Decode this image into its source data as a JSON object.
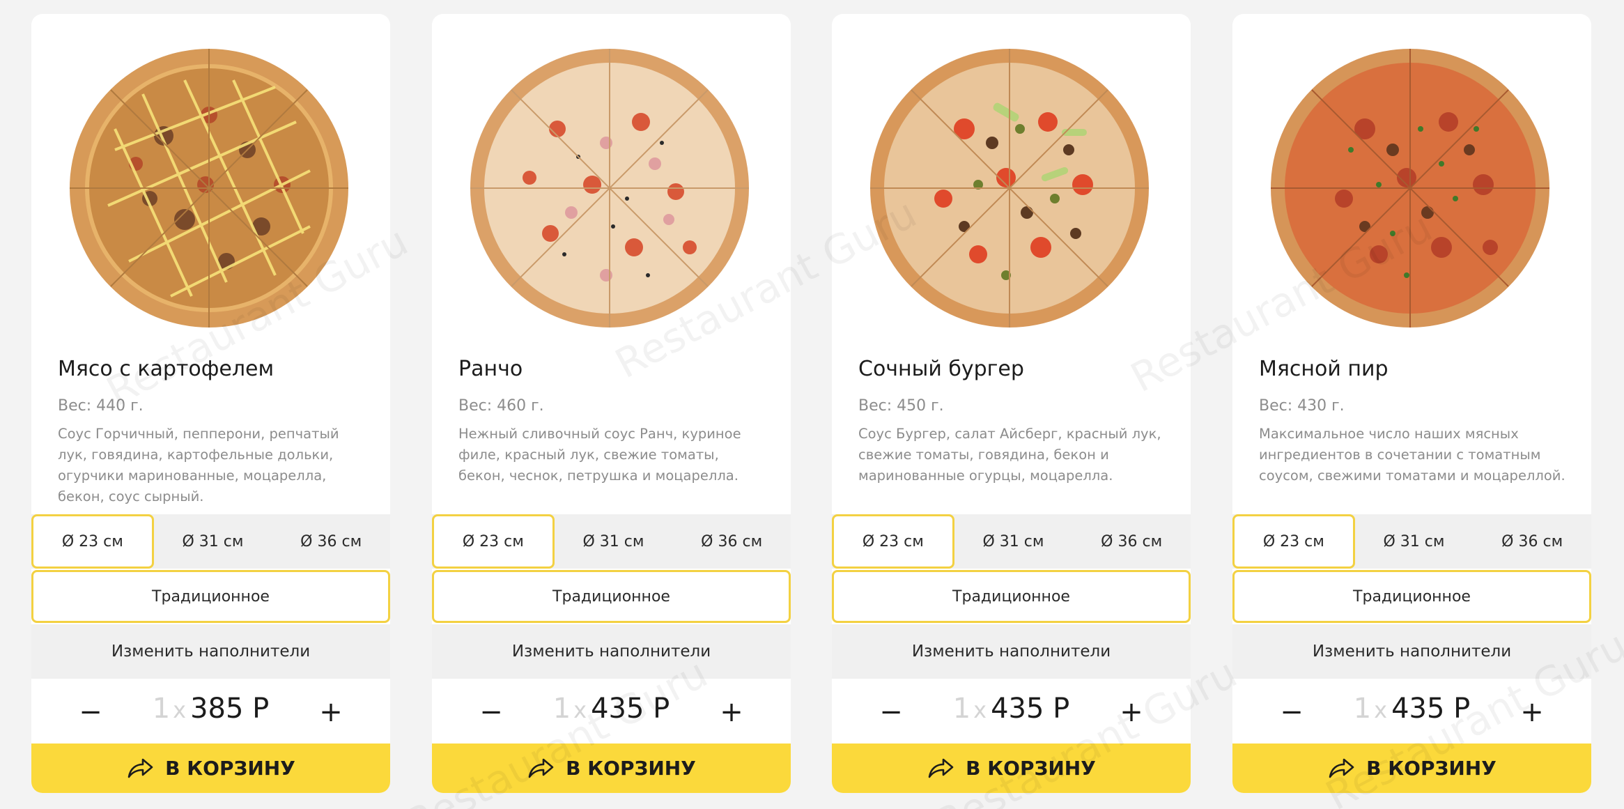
{
  "cards": [
    {
      "name": "Мясо с картофелем",
      "weight": "Вес: 440 г.",
      "description": "Соус Горчичный, пепперони, репчатый лук, говядина, картофельные дольки, огурчики маринованные, моцарелла, бекон, соус сырный.",
      "sizes": [
        "Ø 23 см",
        "Ø 31 см",
        "Ø 36 см"
      ],
      "dough": "Традиционное",
      "toppings_label": "Изменить наполнители",
      "qty": "1",
      "qty_x": "x",
      "price": "385 Р",
      "minus": "−",
      "plus": "+",
      "cart_label": "В КОРЗИНУ"
    },
    {
      "name": "Ранчо",
      "weight": "Вес: 460 г.",
      "description": "Нежный сливочный соус Ранч, куриное филе, красный лук, свежие томаты, бекон, чеснок, петрушка и моцарелла.",
      "sizes": [
        "Ø 23 см",
        "Ø 31 см",
        "Ø 36 см"
      ],
      "dough": "Традиционное",
      "toppings_label": "Изменить наполнители",
      "qty": "1",
      "qty_x": "x",
      "price": "435 Р",
      "minus": "−",
      "plus": "+",
      "cart_label": "В КОРЗИНУ"
    },
    {
      "name": "Сочный бургер",
      "weight": "Вес: 450 г.",
      "description": "Соус Бургер, салат Айсберг, красный лук, свежие томаты, говядина, бекон и маринованные огурцы, моцарелла.",
      "sizes": [
        "Ø 23 см",
        "Ø 31 см",
        "Ø 36 см"
      ],
      "dough": "Традиционное",
      "toppings_label": "Изменить наполнители",
      "qty": "1",
      "qty_x": "x",
      "price": "435 Р",
      "minus": "−",
      "plus": "+",
      "cart_label": "В КОРЗИНУ"
    },
    {
      "name": "Мясной пир",
      "weight": "Вес: 430 г.",
      "description": "Максимальное число наших мясных ингредиентов в сочетании с томатным соусом, свежими томатами и моцареллой.",
      "sizes": [
        "Ø 23 см",
        "Ø 31 см",
        "Ø 36 см"
      ],
      "dough": "Традиционное",
      "toppings_label": "Изменить наполнители",
      "qty": "1",
      "qty_x": "x",
      "price": "435 Р",
      "minus": "−",
      "plus": "+",
      "cart_label": "В КОРЗИНУ"
    }
  ],
  "watermark": "Restaurant Guru",
  "colors": {
    "accent": "#fbd93b",
    "accent_border": "#f3d142",
    "muted_text": "#8c8c8c"
  }
}
